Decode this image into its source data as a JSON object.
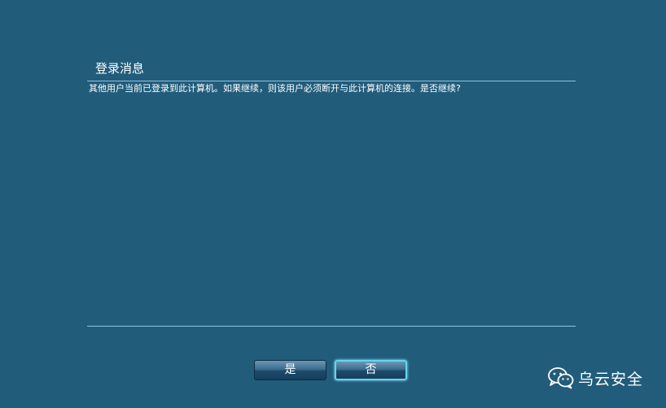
{
  "dialog": {
    "title": "登录消息",
    "message": "其他用户当前已登录到此计算机。如果继续，则该用户必须断开与此计算机的连接。是否继续?"
  },
  "buttons": {
    "yes_label": "是",
    "no_label": "否"
  },
  "watermark": {
    "icon": "wechat-icon",
    "text": "乌云安全"
  },
  "colors": {
    "background": "#215c7b",
    "divider": "#8fc4dc",
    "focus_ring": "#5fd7f2"
  }
}
